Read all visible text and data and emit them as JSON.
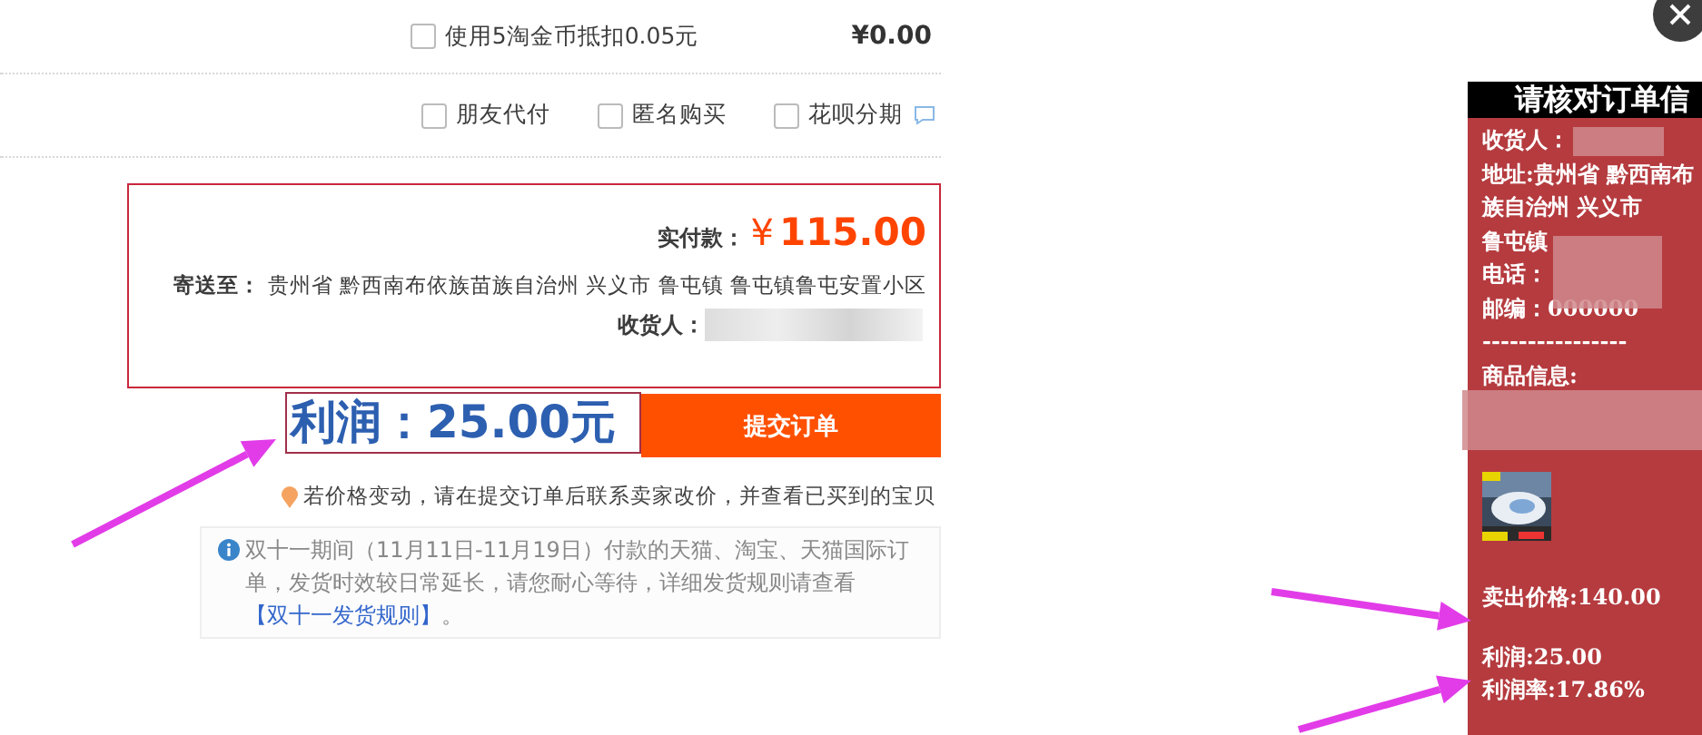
{
  "coin_option": {
    "label": "使用5淘金币抵扣0.05元",
    "checked": false,
    "amount": "¥0.00"
  },
  "options": [
    {
      "label": "朋友代付",
      "checked": false
    },
    {
      "label": "匿名购买",
      "checked": false
    },
    {
      "label": "花呗分期",
      "checked": false
    }
  ],
  "summary": {
    "paid_label": "实付款：",
    "currency": "¥",
    "paid_amount": "115.00",
    "ship_label": "寄送至：",
    "address": "贵州省 黔西南布依族苗族自治州 兴义市 鲁屯镇 鲁屯镇鲁屯安置小区",
    "receiver_label": "收货人："
  },
  "profit_note": "利润：25.00元",
  "submit_button": "提交订单",
  "price_tip": "若价格变动，请在提交订单后联系卖家改价，并查看已买到的宝贝",
  "notice": {
    "text": "双十一期间（11月11日-11月19日）付款的天猫、淘宝、天猫国际订单，发货时效较日常延长，请您耐心等待，详细发货规则请查看",
    "link": "【双十一发货规则】",
    "end": "。"
  },
  "check_panel": {
    "title": "请核对订单信",
    "lines": [
      {
        "kind": "text",
        "text": "收货人："
      },
      {
        "kind": "text",
        "text": "地址:贵州省 黔西南布"
      },
      {
        "kind": "text",
        "text": "族自治州 兴义市"
      },
      {
        "kind": "text",
        "text": "鲁屯镇"
      },
      {
        "kind": "text",
        "text": "电话："
      },
      {
        "kind": "text",
        "text": "邮编：000000"
      },
      {
        "kind": "text",
        "text": "----------------"
      },
      {
        "kind": "text",
        "text": "商品信息:"
      },
      {
        "kind": "thumb"
      },
      {
        "kind": "text",
        "text": "卖出价格:140.00"
      },
      {
        "kind": "gap"
      },
      {
        "kind": "text",
        "text": "利润:25.00"
      },
      {
        "kind": "text",
        "text": "利润率:17.86%"
      }
    ]
  }
}
